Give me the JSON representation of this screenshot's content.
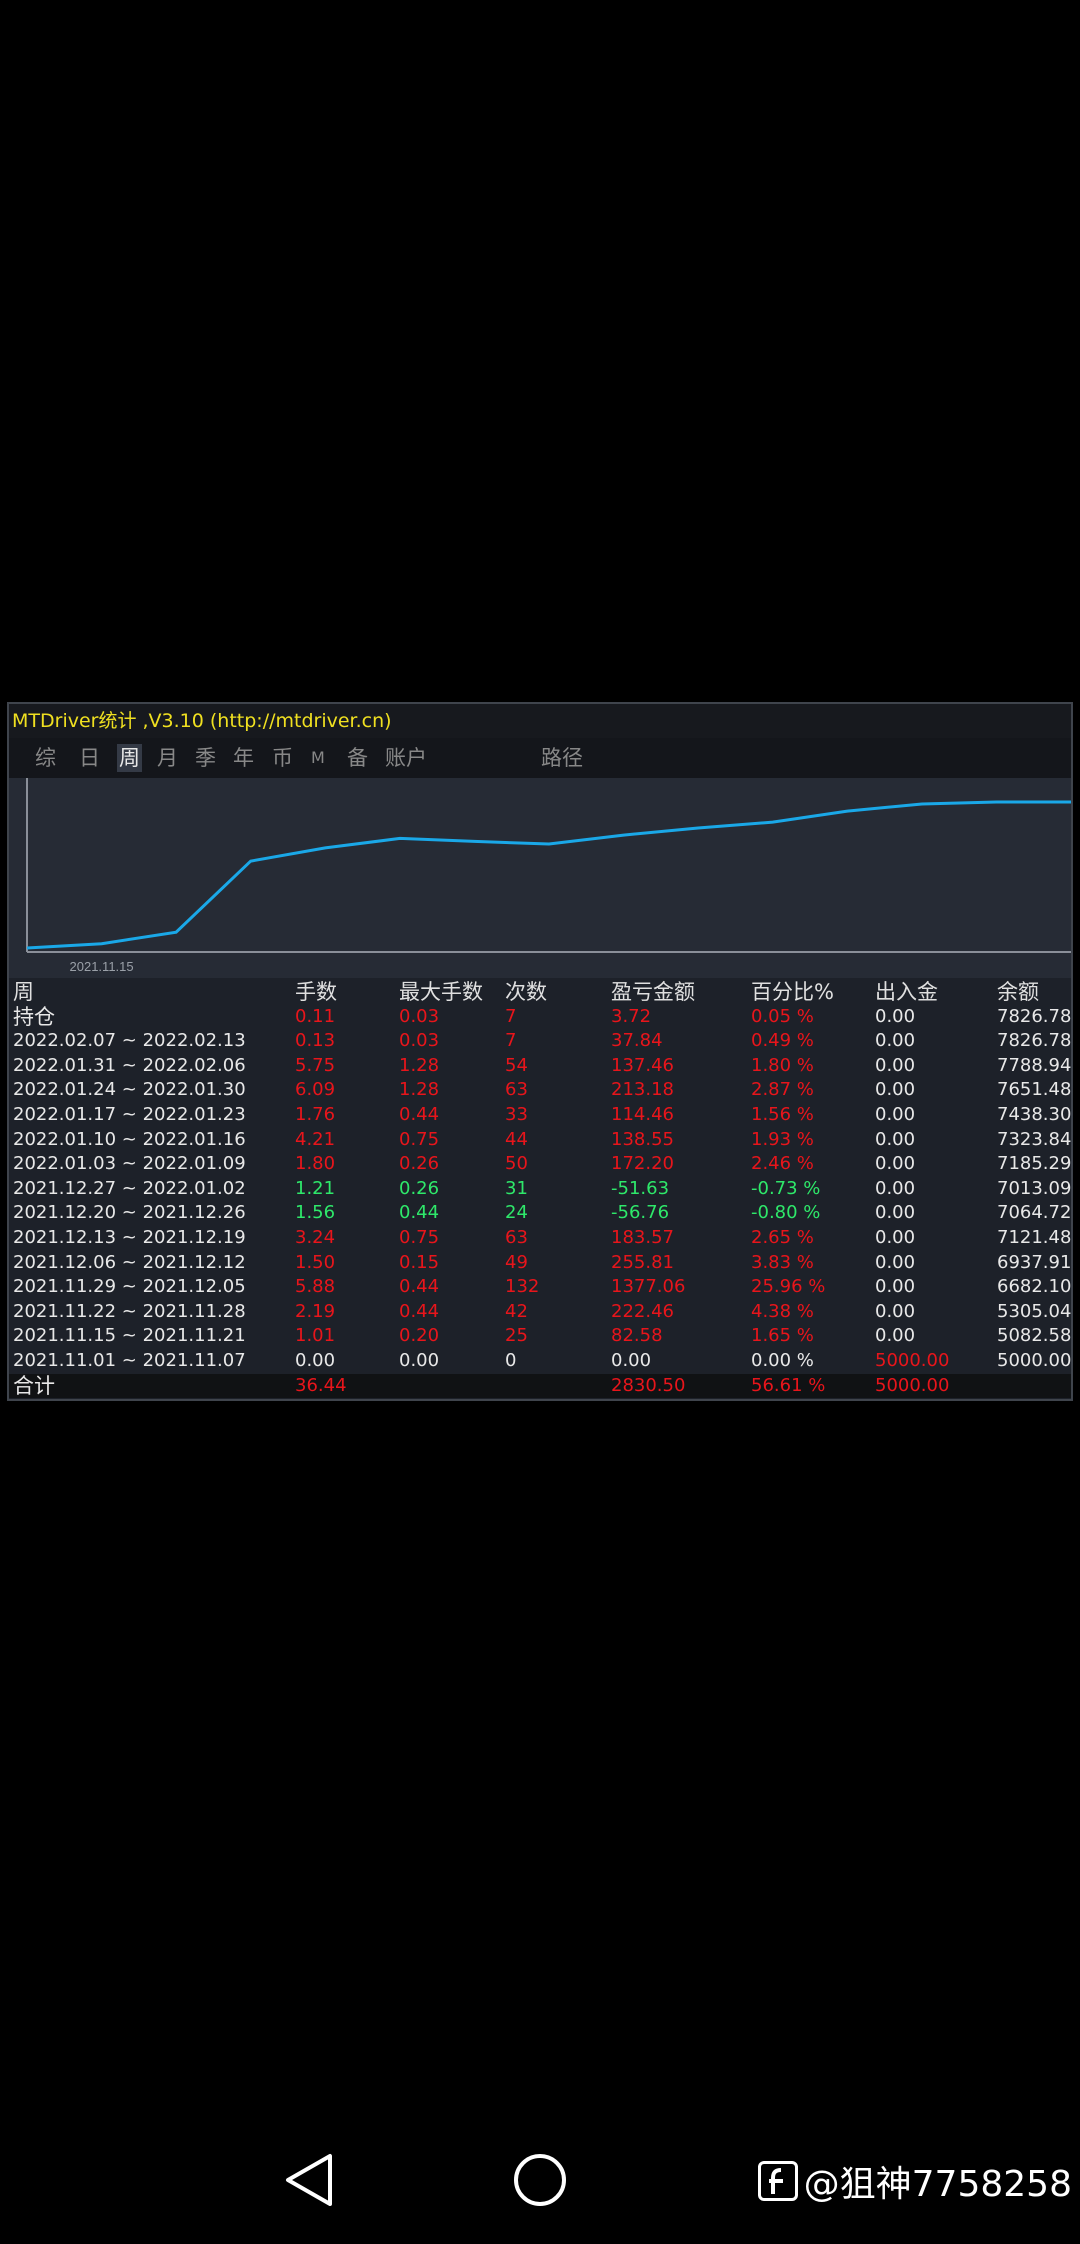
{
  "app": {
    "title": "MTDriver统计 ,V3.10 (http://mtdriver.cn)"
  },
  "tabs": [
    {
      "label": "综",
      "active": false
    },
    {
      "label": "日",
      "active": false
    },
    {
      "label": "周",
      "active": true
    },
    {
      "label": "月",
      "active": false
    },
    {
      "label": "季",
      "active": false
    },
    {
      "label": "年",
      "active": false
    },
    {
      "label": "币",
      "active": false
    },
    {
      "label": "M",
      "active": false
    },
    {
      "label": "备",
      "active": false
    },
    {
      "label": "账户",
      "active": false
    },
    {
      "label": "路径",
      "active": false
    }
  ],
  "chart_data": {
    "type": "line",
    "x_tick_label": "2021.11.15",
    "series": [
      {
        "values": [
          5000.0,
          5082.58,
          5305.04,
          6682.1,
          6937.91,
          7121.48,
          7064.72,
          7013.09,
          7185.29,
          7323.84,
          7438.3,
          7651.48,
          7788.94,
          7826.78,
          7826.78
        ]
      }
    ],
    "color": "#1aa8e8"
  },
  "table": {
    "headers": [
      "周",
      "手数",
      "最大手数",
      "次数",
      "盈亏金额",
      "百分比%",
      "出入金",
      "余额"
    ],
    "rows": [
      {
        "cells": [
          "持仓",
          "0.11",
          "0.03",
          "7",
          "3.72",
          "0.05 %",
          "0.00",
          "7826.78"
        ],
        "colors": [
          "w",
          "r",
          "r",
          "r",
          "r",
          "r",
          "w",
          "w"
        ],
        "header_style": true
      },
      {
        "cells": [
          "2022.02.07 ~ 2022.02.13",
          "0.13",
          "0.03",
          "7",
          "37.84",
          "0.49 %",
          "0.00",
          "7826.78"
        ],
        "colors": [
          "w",
          "r",
          "r",
          "r",
          "r",
          "r",
          "w",
          "w"
        ]
      },
      {
        "cells": [
          "2022.01.31 ~ 2022.02.06",
          "5.75",
          "1.28",
          "54",
          "137.46",
          "1.80 %",
          "0.00",
          "7788.94"
        ],
        "colors": [
          "w",
          "r",
          "r",
          "r",
          "r",
          "r",
          "w",
          "w"
        ]
      },
      {
        "cells": [
          "2022.01.24 ~ 2022.01.30",
          "6.09",
          "1.28",
          "63",
          "213.18",
          "2.87 %",
          "0.00",
          "7651.48"
        ],
        "colors": [
          "w",
          "r",
          "r",
          "r",
          "r",
          "r",
          "w",
          "w"
        ]
      },
      {
        "cells": [
          "2022.01.17 ~ 2022.01.23",
          "1.76",
          "0.44",
          "33",
          "114.46",
          "1.56 %",
          "0.00",
          "7438.30"
        ],
        "colors": [
          "w",
          "r",
          "r",
          "r",
          "r",
          "r",
          "w",
          "w"
        ]
      },
      {
        "cells": [
          "2022.01.10 ~ 2022.01.16",
          "4.21",
          "0.75",
          "44",
          "138.55",
          "1.93 %",
          "0.00",
          "7323.84"
        ],
        "colors": [
          "w",
          "r",
          "r",
          "r",
          "r",
          "r",
          "w",
          "w"
        ]
      },
      {
        "cells": [
          "2022.01.03 ~ 2022.01.09",
          "1.80",
          "0.26",
          "50",
          "172.20",
          "2.46 %",
          "0.00",
          "7185.29"
        ],
        "colors": [
          "w",
          "r",
          "r",
          "r",
          "r",
          "r",
          "w",
          "w"
        ]
      },
      {
        "cells": [
          "2021.12.27 ~ 2022.01.02",
          "1.21",
          "0.26",
          "31",
          "-51.63",
          "-0.73 %",
          "0.00",
          "7013.09"
        ],
        "colors": [
          "w",
          "g",
          "g",
          "g",
          "g",
          "g",
          "w",
          "w"
        ]
      },
      {
        "cells": [
          "2021.12.20 ~ 2021.12.26",
          "1.56",
          "0.44",
          "24",
          "-56.76",
          "-0.80 %",
          "0.00",
          "7064.72"
        ],
        "colors": [
          "w",
          "g",
          "g",
          "g",
          "g",
          "g",
          "w",
          "w"
        ]
      },
      {
        "cells": [
          "2021.12.13 ~ 2021.12.19",
          "3.24",
          "0.75",
          "63",
          "183.57",
          "2.65 %",
          "0.00",
          "7121.48"
        ],
        "colors": [
          "w",
          "r",
          "r",
          "r",
          "r",
          "r",
          "w",
          "w"
        ]
      },
      {
        "cells": [
          "2021.12.06 ~ 2021.12.12",
          "1.50",
          "0.15",
          "49",
          "255.81",
          "3.83 %",
          "0.00",
          "6937.91"
        ],
        "colors": [
          "w",
          "r",
          "r",
          "r",
          "r",
          "r",
          "w",
          "w"
        ]
      },
      {
        "cells": [
          "2021.11.29 ~ 2021.12.05",
          "5.88",
          "0.44",
          "132",
          "1377.06",
          "25.96 %",
          "0.00",
          "6682.10"
        ],
        "colors": [
          "w",
          "r",
          "r",
          "r",
          "r",
          "r",
          "w",
          "w"
        ]
      },
      {
        "cells": [
          "2021.11.22 ~ 2021.11.28",
          "2.19",
          "0.44",
          "42",
          "222.46",
          "4.38 %",
          "0.00",
          "5305.04"
        ],
        "colors": [
          "w",
          "r",
          "r",
          "r",
          "r",
          "r",
          "w",
          "w"
        ]
      },
      {
        "cells": [
          "2021.11.15 ~ 2021.11.21",
          "1.01",
          "0.20",
          "25",
          "82.58",
          "1.65 %",
          "0.00",
          "5082.58"
        ],
        "colors": [
          "w",
          "r",
          "r",
          "r",
          "r",
          "r",
          "w",
          "w"
        ]
      },
      {
        "cells": [
          "2021.11.01 ~ 2021.11.07",
          "0.00",
          "0.00",
          "0",
          "0.00",
          "0.00 %",
          "5000.00",
          "5000.00"
        ],
        "colors": [
          "w",
          "w",
          "w",
          "w",
          "w",
          "w",
          "r",
          "w"
        ]
      },
      {
        "cells": [
          "合计",
          "36.44",
          "",
          "",
          "2830.50",
          "56.61 %",
          "5000.00",
          ""
        ],
        "colors": [
          "w",
          "r",
          "w",
          "w",
          "r",
          "r",
          "r",
          "w"
        ],
        "total": true
      }
    ]
  },
  "watermark": {
    "text": "@狙神7758258"
  }
}
